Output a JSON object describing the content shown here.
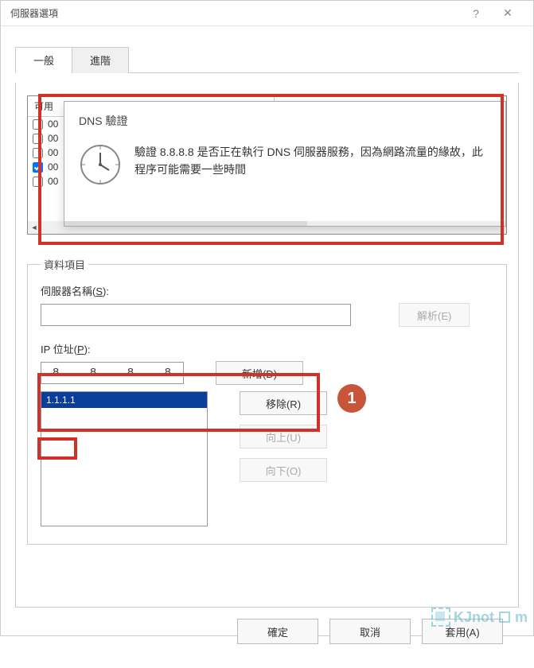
{
  "window": {
    "title": "伺服器選項"
  },
  "tabs": {
    "general": "一般",
    "advanced": "進階"
  },
  "list": {
    "header1": "可用",
    "rows": [
      {
        "checked": false,
        "label": "00"
      },
      {
        "checked": false,
        "label": "00"
      },
      {
        "checked": false,
        "label": "00"
      },
      {
        "checked": true,
        "label": "00"
      },
      {
        "checked": false,
        "label": "00"
      }
    ]
  },
  "dns_dialog": {
    "title": "DNS 驗證",
    "message": "驗證 8.8.8.8 是否正在執行 DNS 伺服器服務，因為網路流量的緣故，此程序可能需要一些時間"
  },
  "group": {
    "legend": "資料項目",
    "server_name_label_pre": "伺服器名稱(",
    "server_name_key": "S",
    "server_name_label_post": "):",
    "server_name_value": "",
    "resolve_label_pre": "解析(",
    "resolve_key": "E",
    "resolve_label_post": ")",
    "ip_label_pre": "IP 位址(",
    "ip_key": "P",
    "ip_label_post": "):",
    "ip_octets": [
      "8",
      "8",
      "8",
      "8"
    ],
    "add_label_pre": "新增(",
    "add_key": "D",
    "add_label_post": ")",
    "ip_list": [
      "1.1.1.1"
    ],
    "remove_label_pre": "移除(",
    "remove_key": "R",
    "remove_label_post": ")",
    "up_label_pre": "向上(",
    "up_key": "U",
    "up_label_post": ")",
    "down_label_pre": "向下(",
    "down_key": "O",
    "down_label_post": ")"
  },
  "footer": {
    "ok": "確定",
    "cancel": "取消",
    "apply_pre": "套用(",
    "apply_key": "A",
    "apply_post": ")"
  },
  "badges": {
    "one": "1"
  },
  "watermark": {
    "text": "KJnot",
    "suffix": "m"
  }
}
